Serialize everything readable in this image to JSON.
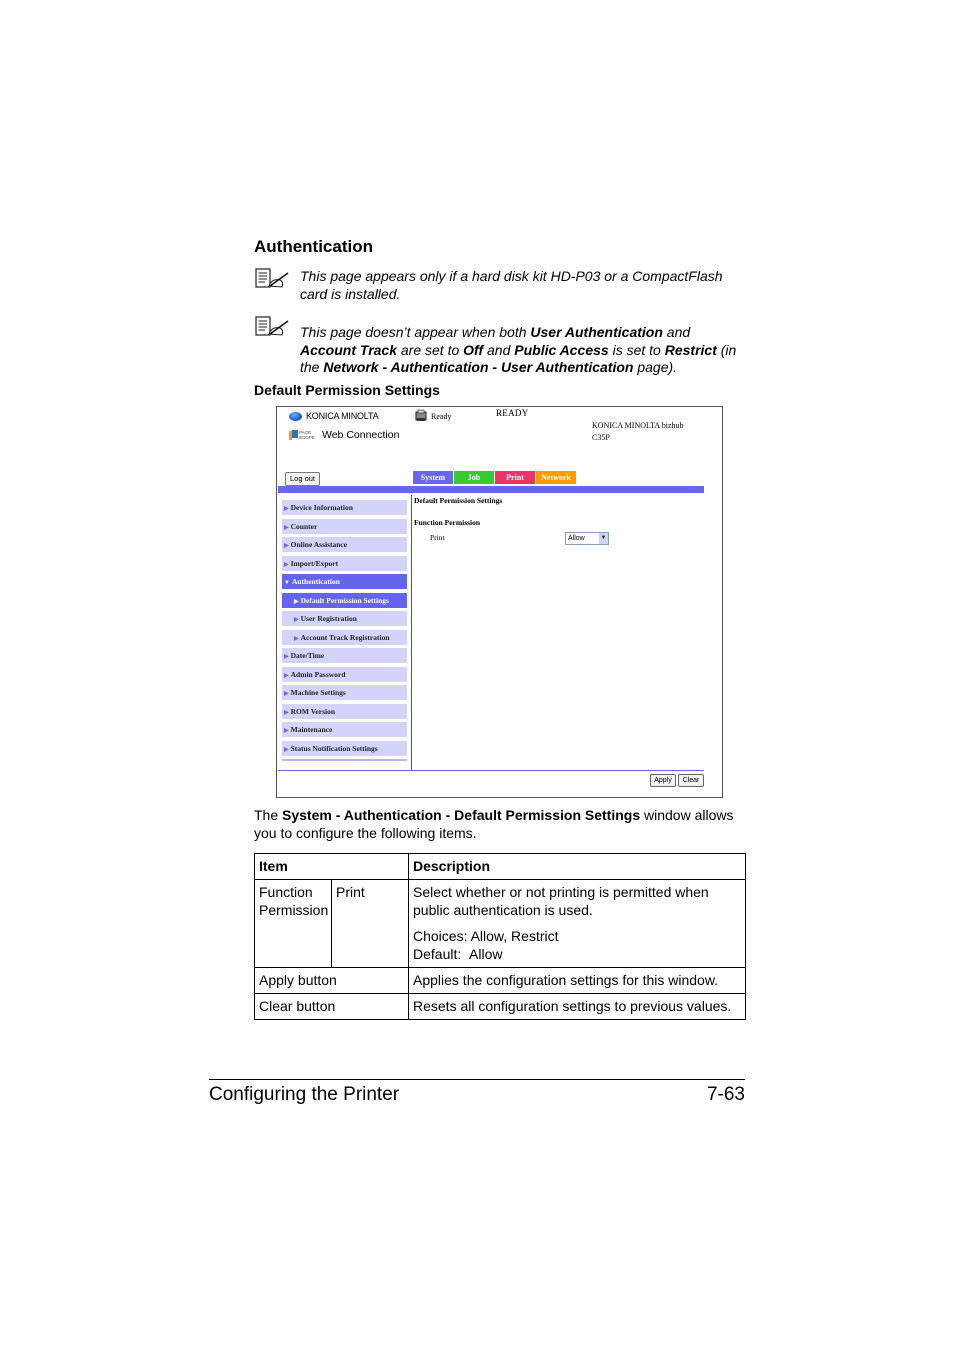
{
  "section": {
    "title": "Authentication",
    "notes": [
      {
        "icon": "note-pencil-icon",
        "text_parts": [
          {
            "t": "This page appears only if a hard disk kit HD-P03 or a CompactFlash card is installed.",
            "b": false
          }
        ]
      },
      {
        "icon": "note-pencil-icon",
        "text_parts": [
          {
            "t": "This page doesn’t appear when both ",
            "b": false
          },
          {
            "t": "User Authentication",
            "b": true
          },
          {
            "t": " and ",
            "b": false
          },
          {
            "t": "Account Track",
            "b": true
          },
          {
            "t": " are set to ",
            "b": false
          },
          {
            "t": "Off",
            "b": true
          },
          {
            "t": " and ",
            "b": false
          },
          {
            "t": "Public Access",
            "b": true
          },
          {
            "t": " is set to ",
            "b": false
          },
          {
            "t": "Restrict",
            "b": true
          },
          {
            "t": " (in the ",
            "b": false
          },
          {
            "t": "Network - Authentication - User Authentication",
            "b": true
          },
          {
            "t": " page).",
            "b": false
          }
        ]
      }
    ],
    "subheading": "Default Permission Settings"
  },
  "screenshot": {
    "brand": "KONICA MINOLTA",
    "web_connection": "Web Connection",
    "pagescope_logo": "PAGE SCOPE",
    "status_small": "Ready",
    "status_big": "READY",
    "model_line1": "KONICA MINOLTA bizhub",
    "model_line2": "C35P",
    "logout_label": "Log out",
    "tabs": [
      {
        "label": "System",
        "color": "#6666ee"
      },
      {
        "label": "Job",
        "color": "#33cc33"
      },
      {
        "label": "Print",
        "color": "#ee3366"
      },
      {
        "label": "Network",
        "color": "#ff9900"
      }
    ],
    "menu": [
      {
        "label": "Device Information",
        "level": 0,
        "active": false,
        "expanded": false
      },
      {
        "label": "Counter",
        "level": 0,
        "active": false,
        "expanded": false
      },
      {
        "label": "Online Assistance",
        "level": 0,
        "active": false,
        "expanded": false
      },
      {
        "label": "Import/Export",
        "level": 0,
        "active": false,
        "expanded": false
      },
      {
        "label": "Authentication",
        "level": 0,
        "active": true,
        "expanded": true
      },
      {
        "label": "Default Permission Settings",
        "level": 1,
        "active": true,
        "expanded": false
      },
      {
        "label": "User Registration",
        "level": 1,
        "active": false,
        "expanded": false
      },
      {
        "label": "Account Track Registration",
        "level": 1,
        "active": false,
        "expanded": false
      },
      {
        "label": "Date/Time",
        "level": 0,
        "active": false,
        "expanded": false
      },
      {
        "label": "Admin Password",
        "level": 0,
        "active": false,
        "expanded": false
      },
      {
        "label": "Machine Settings",
        "level": 0,
        "active": false,
        "expanded": false
      },
      {
        "label": "ROM Version",
        "level": 0,
        "active": false,
        "expanded": false
      },
      {
        "label": "Maintenance",
        "level": 0,
        "active": false,
        "expanded": false
      },
      {
        "label": "Status Notification Settings",
        "level": 0,
        "active": false,
        "expanded": false
      }
    ],
    "content": {
      "title": "Default Permission Settings",
      "group": "Function Permission",
      "row_label": "Print",
      "select_value": "Allow"
    },
    "apply_label": "Apply",
    "clear_label": "Clear"
  },
  "intro_parts": [
    {
      "t": "The ",
      "b": false
    },
    {
      "t": "System - Authentication - Default Permission Settings",
      "b": true
    },
    {
      "t": " window allows you to configure the following items.",
      "b": false
    }
  ],
  "table": {
    "headers": {
      "item": "Item",
      "description": "Description"
    },
    "rows": {
      "function_permission": {
        "item": "Function Permission",
        "subitem": "Print",
        "desc": "Select whether or not printing is permitted when public authentication is used.",
        "choices": "Choices: Allow, Restrict",
        "default": "Default:  Allow"
      },
      "apply": {
        "item": "Apply button",
        "desc": "Applies the configuration settings for this window."
      },
      "clear": {
        "item": "Clear button",
        "desc": "Resets all configuration settings to previous values."
      }
    }
  },
  "footer": {
    "left": "Configuring the Printer",
    "right": "7-63"
  }
}
